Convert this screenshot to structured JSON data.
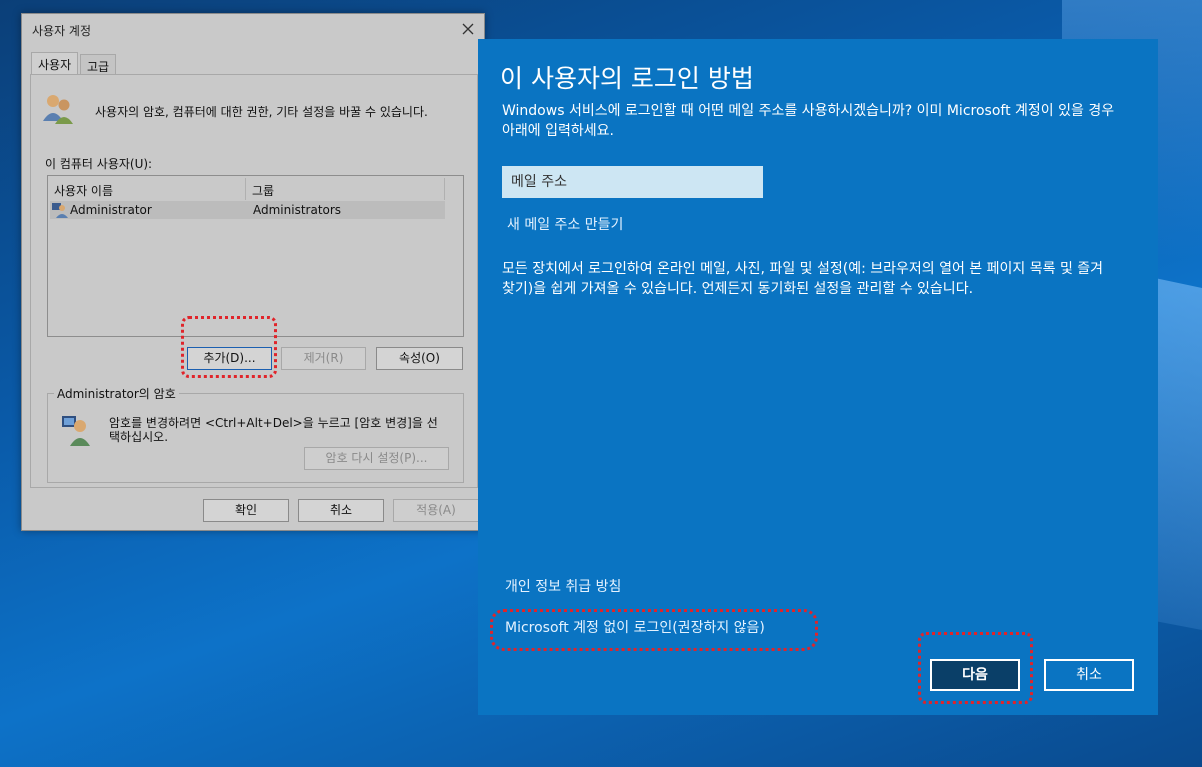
{
  "colors": {
    "desktop_blue": "#0a5aa8",
    "panel_blue": "#0a74c2",
    "primary_button": "#0a3f68",
    "highlight_dash": "#e0242a",
    "dialog_gray": "#c9c9c9"
  },
  "dialog": {
    "title": "사용자 계정",
    "close_icon": "close-icon",
    "tabs": [
      {
        "label": "사용자",
        "active": true
      },
      {
        "label": "고급",
        "active": false
      }
    ],
    "intro": "사용자의 암호, 컴퓨터에 대한 권한, 기타 설정을 바꿀 수 있습니다.",
    "users_label": "이 컴퓨터 사용자(U):",
    "columns": [
      "사용자 이름",
      "그룹"
    ],
    "rows": [
      {
        "name": "Administrator",
        "group": "Administrators"
      }
    ],
    "buttons": {
      "add": "추가(D)...",
      "remove": "제거(R)",
      "properties": "속성(O)"
    },
    "password_group": {
      "label": "Administrator의 암호",
      "text_line1": "암호를 변경하려면 <Ctrl+Alt+Del>을 누르고 [암호 변경]을 선",
      "text_line2": "택하십시오.",
      "reset_button": "암호 다시 설정(P)..."
    },
    "footer": {
      "ok": "확인",
      "cancel": "취소",
      "apply": "적용(A)"
    }
  },
  "signin_panel": {
    "title": "이 사용자의 로그인 방법",
    "description": "Windows 서비스에 로그인할 때 어떤 메일 주소를 사용하시겠습니까? 이미 Microsoft 계정이 있을 경우 아래에 입력하세요.",
    "email_placeholder": "메일 주소",
    "email_value": "",
    "create_email_link": "새 메일 주소 만들기",
    "body": "모든 장치에서 로그인하여 온라인 메일, 사진, 파일 및 설정(예: 브라우저의 열어 본 페이지 목록 및 즐겨찾기)을 쉽게 가져올 수 있습니다. 언제든지 동기화된 설정을 관리할 수 있습니다.",
    "privacy_link": "개인 정보 취급 방침",
    "no_account_link": "Microsoft 계정 없이 로그인(권장하지 않음)",
    "next_button": "다음",
    "cancel_button": "취소"
  }
}
